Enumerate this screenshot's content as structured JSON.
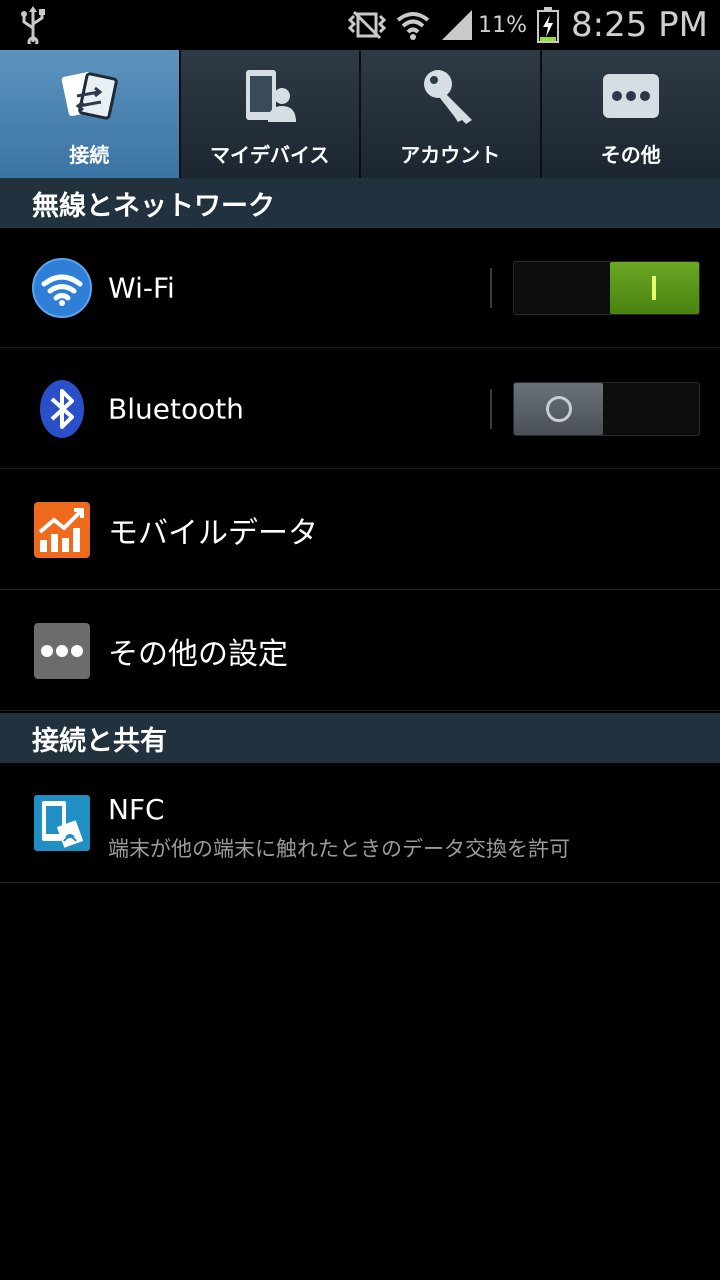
{
  "status_bar": {
    "battery_text": "11%",
    "time": "8:25 PM",
    "icons": [
      "usb-icon",
      "vibrate-icon",
      "wifi-signal-icon",
      "cell-signal-icon",
      "battery-charging-icon"
    ]
  },
  "tabs": [
    {
      "label": "接続",
      "icon": "connections-icon",
      "active": true
    },
    {
      "label": "マイデバイス",
      "icon": "my-device-icon",
      "active": false
    },
    {
      "label": "アカウント",
      "icon": "accounts-icon",
      "active": false
    },
    {
      "label": "その他",
      "icon": "more-icon",
      "active": false
    }
  ],
  "sections": [
    {
      "header": "無線とネットワーク",
      "items": [
        {
          "title": "Wi-Fi",
          "icon": "wifi-icon",
          "toggle": true
        },
        {
          "title": "Bluetooth",
          "icon": "bluetooth-icon",
          "toggle": false
        },
        {
          "title": "モバイルデータ",
          "icon": "mobile-data-icon"
        },
        {
          "title": "その他の設定",
          "icon": "more-settings-icon"
        }
      ]
    },
    {
      "header": "接続と共有",
      "items": [
        {
          "title": "NFC",
          "summary": "端末が他の端末に触れたときのデータ交換を許可",
          "icon": "nfc-icon"
        }
      ]
    }
  ],
  "colors": {
    "active_tab": "#4a84b2",
    "section_header": "#21313e",
    "toggle_on": "#5a9618",
    "toggle_off": "#5a6066"
  }
}
